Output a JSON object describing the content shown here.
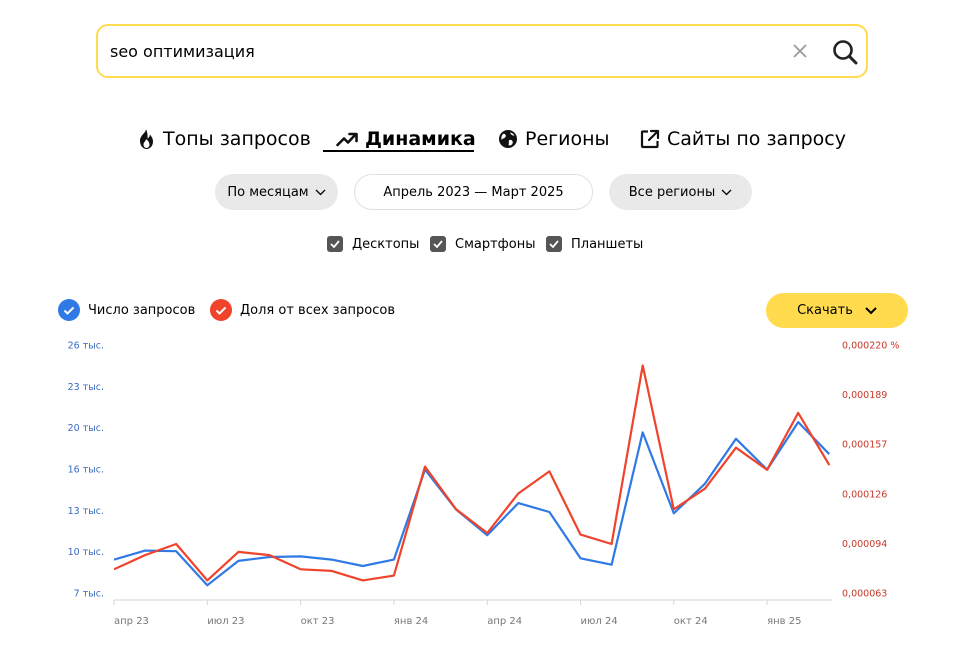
{
  "search": {
    "value": "seo оптимизация",
    "clear_icon": "close-icon",
    "search_icon": "magnifier-icon"
  },
  "tabs": [
    {
      "label": "Топы запросов",
      "icon": "fire-icon",
      "active": false
    },
    {
      "label": "Динамика",
      "icon": "trend-up-icon",
      "active": true
    },
    {
      "label": "Регионы",
      "icon": "globe-icon",
      "active": false
    },
    {
      "label": "Сайты по запросу",
      "icon": "external-link-icon",
      "active": false
    }
  ],
  "filters": {
    "period_group": "По месяцам",
    "date_range": "Апрель 2023 — Март 2025",
    "region": "Все регионы"
  },
  "devices": [
    {
      "label": "Десктопы",
      "checked": true
    },
    {
      "label": "Смартфоны",
      "checked": true
    },
    {
      "label": "Планшеты",
      "checked": true
    }
  ],
  "legend": [
    {
      "label": "Число запросов",
      "color": "#2f7ae5",
      "checked": true
    },
    {
      "label": "Доля от всех запросов",
      "color": "#f0432b",
      "checked": true
    }
  ],
  "download": {
    "label": "Скачать"
  },
  "chart_data": {
    "type": "line",
    "x": [
      "2023-04",
      "2023-05",
      "2023-06",
      "2023-07",
      "2023-08",
      "2023-09",
      "2023-10",
      "2023-11",
      "2023-12",
      "2024-01",
      "2024-02",
      "2024-03",
      "2024-04",
      "2024-05",
      "2024-06",
      "2024-07",
      "2024-08",
      "2024-09",
      "2024-10",
      "2024-11",
      "2024-12",
      "2025-01",
      "2025-02",
      "2025-03"
    ],
    "x_tick_labels": [
      "апр 23",
      "июл 23",
      "окт 23",
      "янв 24",
      "апр 24",
      "июл 24",
      "окт 24",
      "янв 25"
    ],
    "y_left": {
      "tick_labels": [
        "7 тыс.",
        "10 тыс.",
        "13 тыс.",
        "16 тыс.",
        "20 тыс.",
        "23 тыс.",
        "26 тыс."
      ],
      "range": [
        6700,
        26000
      ]
    },
    "y_right": {
      "tick_labels": [
        "0,000063",
        "0,000094",
        "0,000126",
        "0,000157",
        "0,000189",
        "0,000220 %"
      ],
      "range": [
        6.3e-05,
        0.00022
      ]
    },
    "series": [
      {
        "name": "Число запросов",
        "axis": "left",
        "color": "#2f7ae5",
        "values": [
          9300,
          10000,
          9950,
          7300,
          9200,
          9500,
          9550,
          9300,
          8800,
          9300,
          16300,
          13200,
          11200,
          13700,
          13000,
          9400,
          8900,
          19200,
          12900,
          15200,
          18700,
          16300,
          20000,
          17500
        ]
      },
      {
        "name": "Доля от всех запросов",
        "axis": "right",
        "color": "#f0432b",
        "values": [
          7.8e-05,
          8.7e-05,
          9.4e-05,
          7.1e-05,
          8.9e-05,
          8.7e-05,
          7.8e-05,
          7.7e-05,
          7.1e-05,
          7.4e-05,
          0.000143,
          0.000116,
          0.000101,
          0.000126,
          0.00014,
          0.0001,
          9.4e-05,
          0.000207,
          0.000116,
          0.000129,
          0.000155,
          0.000141,
          0.000177,
          0.000144
        ]
      }
    ],
    "grid": false
  }
}
